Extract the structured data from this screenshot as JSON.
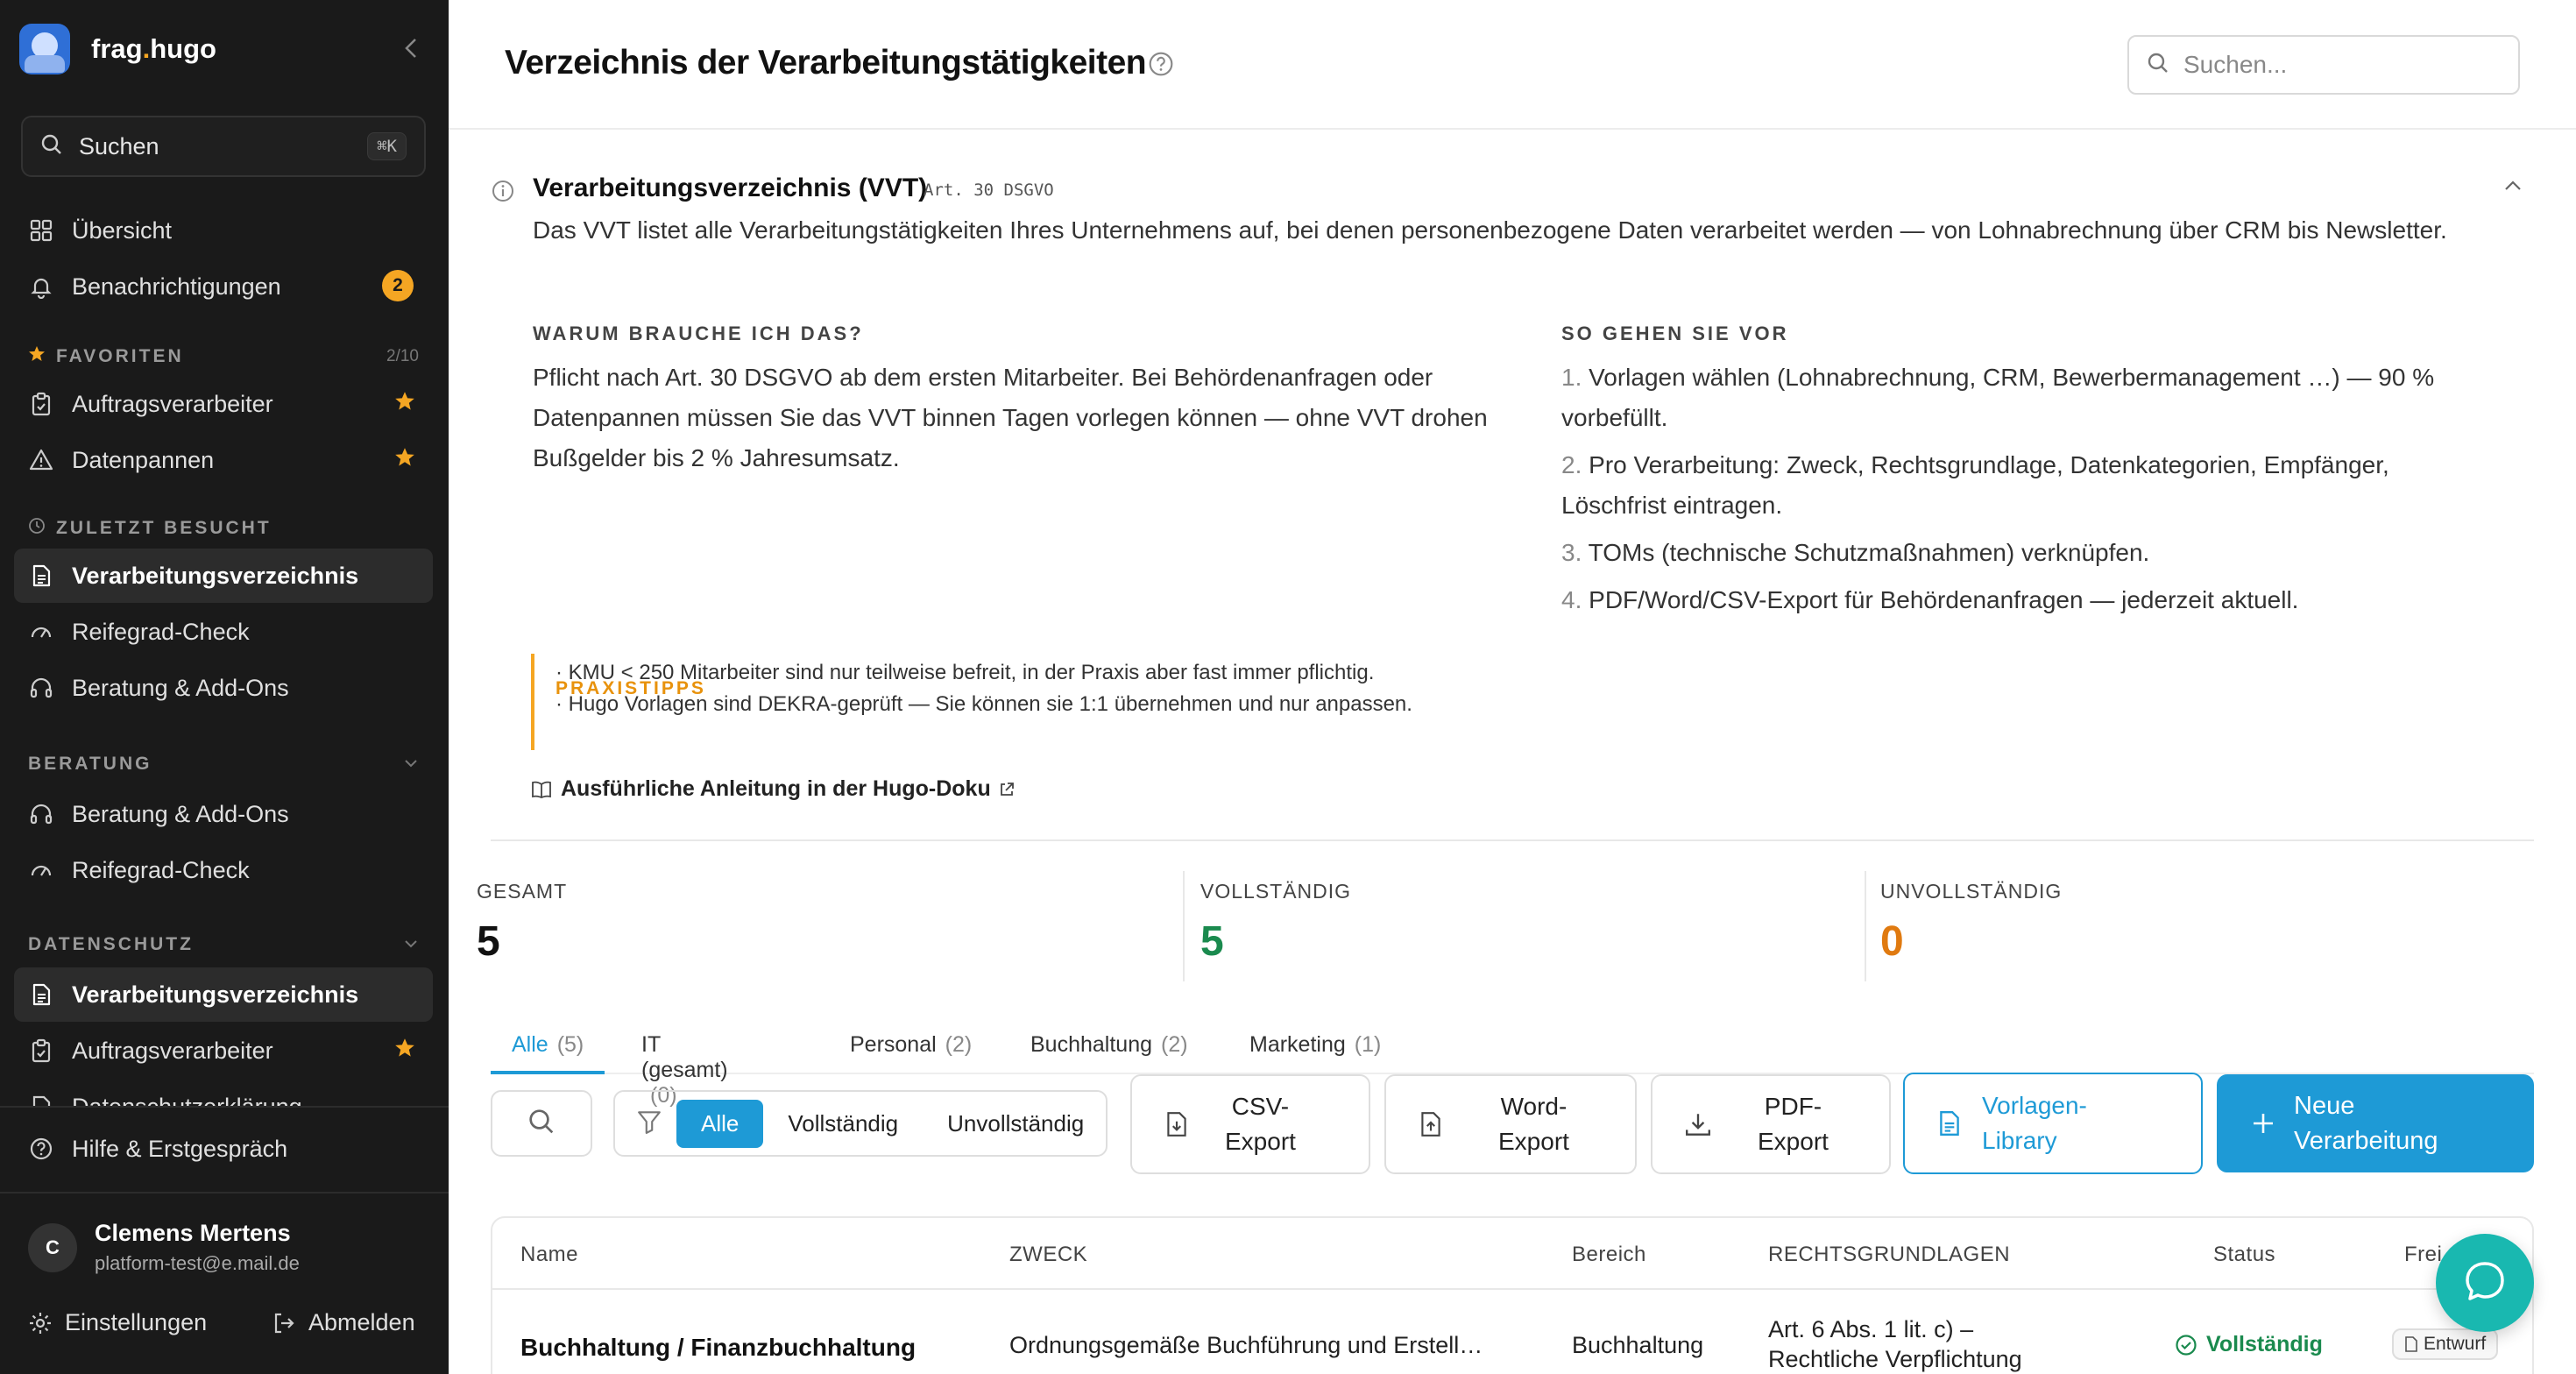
{
  "brand": {
    "name_part1": "frag",
    "name_dot": ".",
    "name_part2": "hugo"
  },
  "sidebar": {
    "search_label": "Suchen",
    "search_shortcut": "⌘K",
    "top_items": [
      {
        "label": "Übersicht",
        "icon": "grid-icon"
      },
      {
        "label": "Benachrichtigungen",
        "icon": "bell-icon",
        "badge": "2"
      }
    ],
    "favorites": {
      "heading": "FAVORITEN",
      "count": "2/10",
      "items": [
        {
          "label": "Auftragsverarbeiter",
          "icon": "clipboard-icon"
        },
        {
          "label": "Datenpannen",
          "icon": "warning-icon"
        }
      ]
    },
    "recent": {
      "heading": "ZULETZT BESUCHT",
      "items": [
        {
          "label": "Verarbeitungsverzeichnis",
          "icon": "document-icon"
        },
        {
          "label": "Reifegrad-Check",
          "icon": "gauge-icon"
        },
        {
          "label": "Beratung & Add-Ons",
          "icon": "headset-icon"
        }
      ]
    },
    "beratung": {
      "heading": "BERATUNG",
      "items": [
        {
          "label": "Beratung & Add-Ons",
          "icon": "headset-icon"
        },
        {
          "label": "Reifegrad-Check",
          "icon": "gauge-icon"
        }
      ]
    },
    "datenschutz": {
      "heading": "DATENSCHUTZ",
      "items": [
        {
          "label": "Verarbeitungsverzeichnis",
          "icon": "document-icon"
        },
        {
          "label": "Auftragsverarbeiter",
          "icon": "clipboard-icon"
        },
        {
          "label": "Datenschutzerklärung",
          "icon": "document-icon"
        }
      ]
    },
    "help_label": "Hilfe & Erstgespräch",
    "user": {
      "initial": "C",
      "name": "Clemens Mertens",
      "email": "platform-test@e.mail.de"
    },
    "settings_label": "Einstellungen",
    "logout_label": "Abmelden"
  },
  "header": {
    "title": "Verzeichnis der Verarbeitungstätigkeiten",
    "search_placeholder": "Suchen..."
  },
  "info": {
    "title": "Verarbeitungsverzeichnis (VVT)",
    "tag": "Art. 30 DSGVO",
    "description": "Das VVT listet alle Verarbeitungstätigkeiten Ihres Unternehmens auf, bei denen personenbezogene Daten verarbeitet werden — von Lohnabrechnung über CRM bis Newsletter.",
    "why_heading": "WARUM BRAUCHE ICH DAS?",
    "why_text": "Pflicht nach Art. 30 DSGVO ab dem ersten Mitarbeiter. Bei Behördenanfragen oder Datenpannen müssen Sie das VVT binnen Tagen vorlegen können — ohne VVT drohen Bußgelder bis 2 % Jahresumsatz.",
    "how_heading": "SO GEHEN SIE VOR",
    "steps": [
      {
        "n": "1.",
        "text": "Vorlagen wählen (Lohnabrechnung, CRM, Bewerbermanagement …) — 90 % vorbefüllt."
      },
      {
        "n": "2.",
        "text": "Pro Verarbeitung: Zweck, Rechtsgrundlage, Datenkategorien, Empfänger, Löschfrist eintragen."
      },
      {
        "n": "3.",
        "text": "TOMs (technische Schutzmaßnahmen) verknüpfen."
      },
      {
        "n": "4.",
        "text": "PDF/Word/CSV-Export für Behördenanfragen — jederzeit aktuell."
      }
    ],
    "tips_heading": "PRAXISTIPPS",
    "tips": [
      "· KMU < 250 Mitarbeiter sind nur teilweise befreit, in der Praxis aber fast immer pflichtig.",
      "· Hugo Vorlagen sind DEKRA-geprüft — Sie können sie 1:1 übernehmen und nur anpassen."
    ],
    "doc_link": "Ausführliche Anleitung in der Hugo-Doku"
  },
  "stats": {
    "total_label": "GESAMT",
    "total_value": "5",
    "complete_label": "VOLLSTÄNDIG",
    "complete_value": "5",
    "incomplete_label": "UNVOLLSTÄNDIG",
    "incomplete_value": "0"
  },
  "colors": {
    "accent": "#1e9ad6",
    "complete": "#1a8a4e",
    "incomplete": "#e07a10",
    "favorite": "#f5a623",
    "chat": "#19b8b0"
  },
  "tabs": [
    {
      "label": "Alle",
      "count": "(5)"
    },
    {
      "label": "IT (gesamt)",
      "count": "(0)"
    },
    {
      "label": "Personal",
      "count": "(2)"
    },
    {
      "label": "Buchhaltung",
      "count": "(2)"
    },
    {
      "label": "Marketing",
      "count": "(1)"
    }
  ],
  "filters": {
    "all": "Alle",
    "complete": "Vollständig",
    "incomplete": "Unvollständig"
  },
  "toolbar": {
    "csv_l1": "CSV-",
    "csv_l2": "Export",
    "word_l1": "Word-",
    "word_l2": "Export",
    "pdf_l1": "PDF-",
    "pdf_l2": "Export",
    "library_l1": "Vorlagen-",
    "library_l2": "Library",
    "new_l1": "Neue",
    "new_l2": "Verarbeitung"
  },
  "table": {
    "headers": {
      "name": "Name",
      "purpose": "ZWECK",
      "area": "Bereich",
      "legal": "RECHTSGRUNDLAGEN",
      "status": "Status",
      "release": "Frei"
    },
    "rows": [
      {
        "name": "Buchhaltung / Finanzbuchhaltung",
        "purpose": "Ordnungsgemäße Buchführung und Erstell…",
        "area": "Buchhaltung",
        "legal_l1": "Art. 6 Abs. 1 lit. c) –",
        "legal_l2": "Rechtliche Verpflichtung",
        "status": "Vollständig",
        "release": "Entwurf"
      }
    ]
  }
}
